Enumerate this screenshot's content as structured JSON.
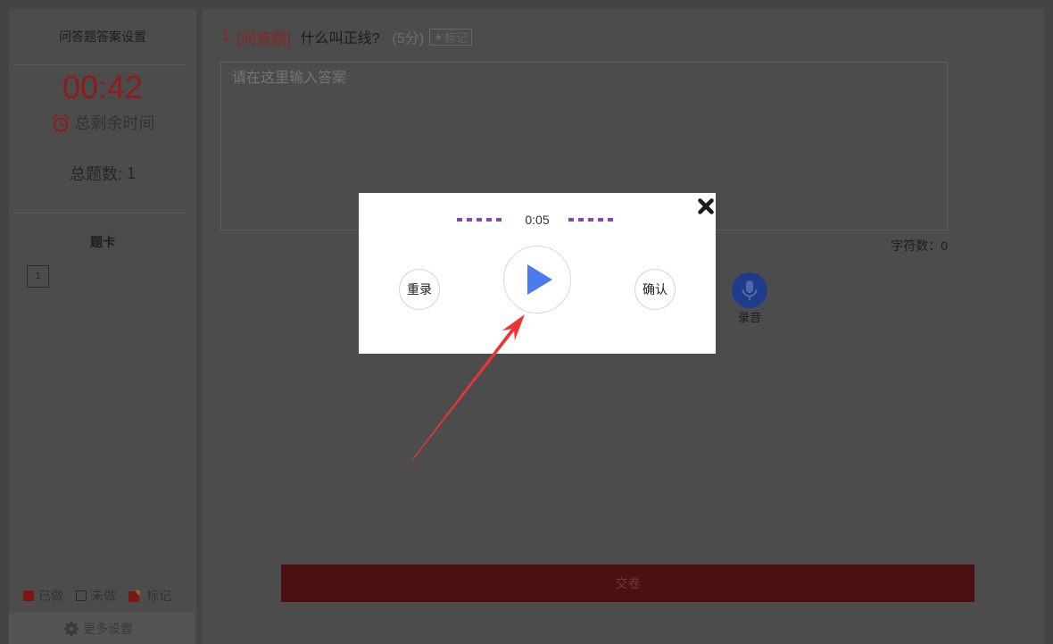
{
  "sidebar": {
    "title": "问答题答案设置",
    "timer": "00:42",
    "timer_label": "总剩余时间",
    "total_label": "总题数:",
    "total_count": "1",
    "card_title": "题卡",
    "cards": [
      "1"
    ],
    "legend": {
      "done": "已做",
      "undone": "未做",
      "marked": "标记"
    },
    "more_settings": "更多设置"
  },
  "question": {
    "number": "1.",
    "type": "[问答题]",
    "text": "什么叫正线?",
    "score": "(5分)",
    "mark_label": "标记"
  },
  "answer": {
    "value": "",
    "placeholder": "请在这里输入答案",
    "char_count_label": "字符数：",
    "char_count": "0"
  },
  "record": {
    "label": "录音"
  },
  "submit": {
    "label": "交卷"
  },
  "modal": {
    "elapsed": "0:05",
    "rerecord_label": "重录",
    "confirm_label": "确认"
  },
  "icons": {
    "timer": "alarm-clock-icon",
    "settings": "gear-icon",
    "mark": "star-icon",
    "record": "microphone-icon",
    "play": "play-icon",
    "close": "close-icon"
  },
  "colors": {
    "accent_red": "#b32222",
    "submit_red": "#5e1515",
    "record_blue": "#274cad",
    "play_blue": "#4b7bec",
    "wave_purple": "#8e44ad",
    "annotation_red": "#ee3434",
    "overlay": "rgba(0,0,0,0.2)"
  }
}
